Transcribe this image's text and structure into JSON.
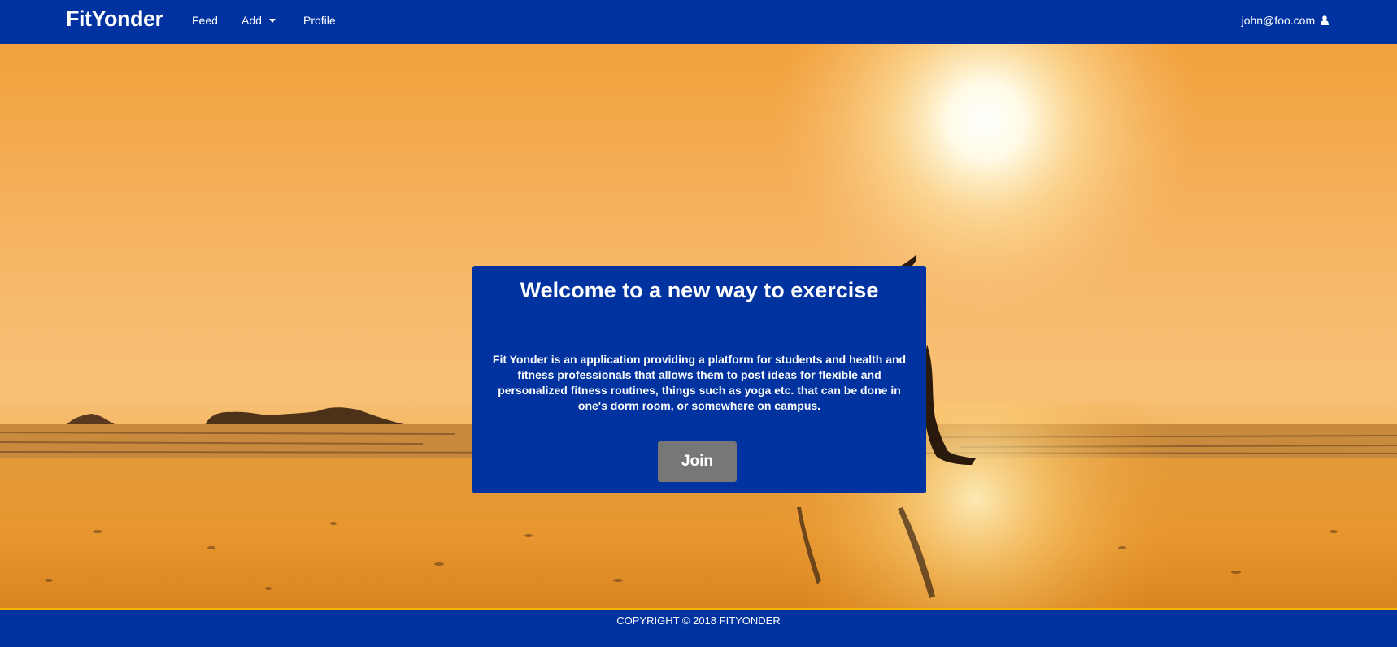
{
  "navbar": {
    "brand": "FitYonder",
    "items": [
      {
        "label": "Feed"
      },
      {
        "label": "Add"
      },
      {
        "label": "Profile"
      }
    ],
    "user_email": "john@foo.com",
    "user_icon": "user-icon",
    "background_color": "#0033a0"
  },
  "hero": {
    "title": "Welcome to a new way to exercise",
    "description": "Fit Yonder is an application providing a platform for students and health and fitness professionals that allows them to post ideas for flexible and personalized fitness routines, things such as yoga etc. that can be done in one's dorm room, or somewhere on campus.",
    "join_label": "Join",
    "box_color": "#0033a0",
    "button_color": "#777777"
  },
  "footer": {
    "copyright": "COPYRIGHT © 2018 FITYONDER",
    "accent_color": "#f5b700"
  }
}
